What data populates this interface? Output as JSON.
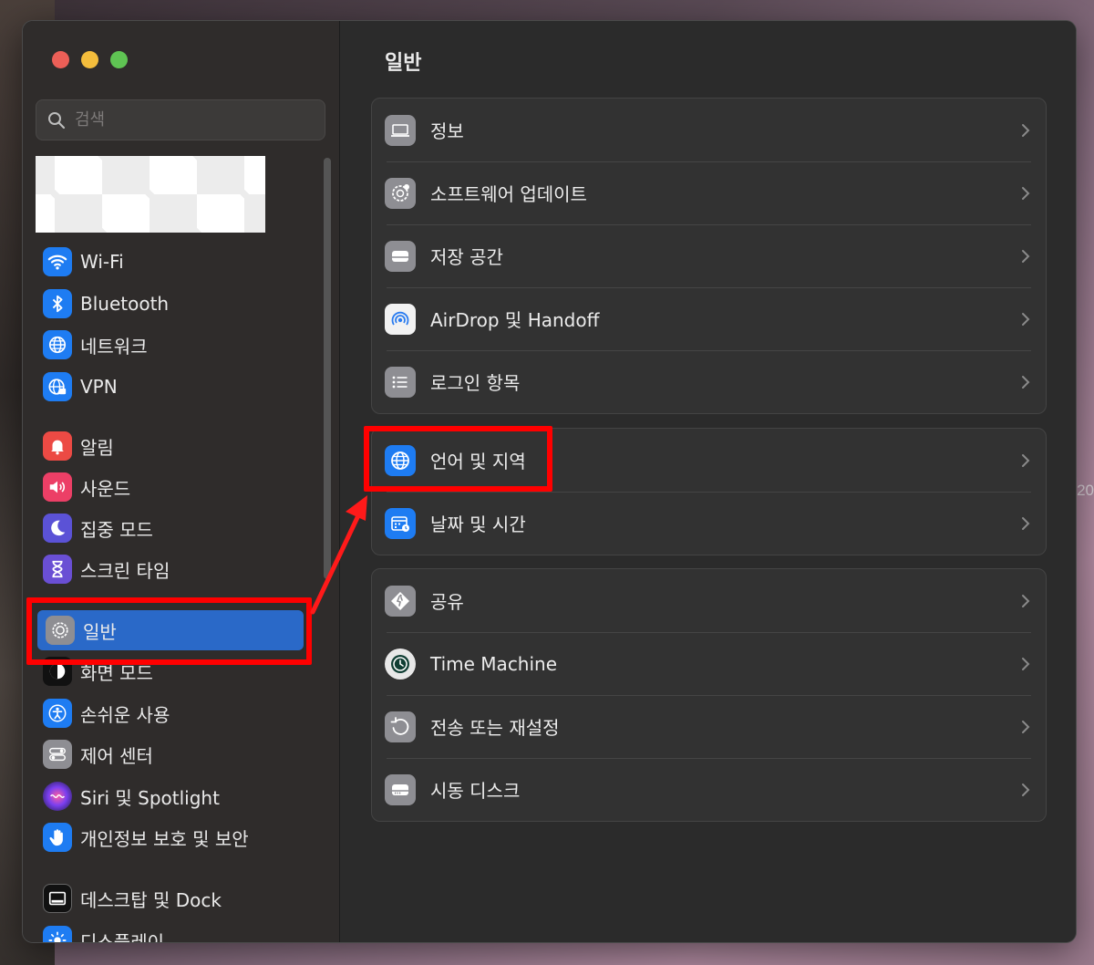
{
  "background": {
    "edge_text": "20"
  },
  "sidebar": {
    "search_placeholder": "검색",
    "items": [
      {
        "label": "Wi-Fi",
        "icon": "wifi-icon",
        "color": "#1e7cf2"
      },
      {
        "label": "Bluetooth",
        "icon": "bluetooth-icon",
        "color": "#1e7cf2"
      },
      {
        "label": "네트워크",
        "icon": "network-globe-icon",
        "color": "#1e7cf2"
      },
      {
        "label": "VPN",
        "icon": "vpn-globe-icon",
        "color": "#1e7cf2"
      },
      {
        "label": "알림",
        "icon": "bell-icon",
        "color": "#ec4a44"
      },
      {
        "label": "사운드",
        "icon": "speaker-icon",
        "color": "#ec3f66"
      },
      {
        "label": "집중 모드",
        "icon": "moon-icon",
        "color": "#5b52d6"
      },
      {
        "label": "스크린 타임",
        "icon": "hourglass-icon",
        "color": "#6a4fd4"
      },
      {
        "label": "일반",
        "icon": "gear-icon",
        "color": "#8e8e93",
        "selected": true
      },
      {
        "label": "화면 모드",
        "icon": "appearance-icon",
        "color": "#111111"
      },
      {
        "label": "손쉬운 사용",
        "icon": "accessibility-icon",
        "color": "#1e7cf2"
      },
      {
        "label": "제어 센터",
        "icon": "control-center-icon",
        "color": "#8e8e93"
      },
      {
        "label": "Siri 및 Spotlight",
        "icon": "siri-icon",
        "color": "#5a3fd0"
      },
      {
        "label": "개인정보 보호 및 보안",
        "icon": "hand-icon",
        "color": "#1e7cf2"
      },
      {
        "label": "데스크탑 및 Dock",
        "icon": "dock-icon",
        "color": "#111111"
      },
      {
        "label": "디스플레이",
        "icon": "display-sun-icon",
        "color": "#1e7cf2"
      }
    ]
  },
  "main": {
    "title": "일반",
    "groups": [
      [
        {
          "label": "정보",
          "icon": "laptop-icon"
        },
        {
          "label": "소프트웨어 업데이트",
          "icon": "software-update-gear-icon"
        },
        {
          "label": "저장 공간",
          "icon": "storage-drive-icon"
        },
        {
          "label": "AirDrop 및 Handoff",
          "icon": "airdrop-icon"
        },
        {
          "label": "로그인 항목",
          "icon": "list-icon"
        }
      ],
      [
        {
          "label": "언어 및 지역",
          "icon": "language-globe-icon"
        },
        {
          "label": "날짜 및 시간",
          "icon": "calendar-clock-icon"
        }
      ],
      [
        {
          "label": "공유",
          "icon": "sharing-icon"
        },
        {
          "label": "Time Machine",
          "icon": "time-machine-icon"
        },
        {
          "label": "전송 또는 재설정",
          "icon": "reset-icon"
        },
        {
          "label": "시동 디스크",
          "icon": "startup-disk-icon"
        }
      ]
    ]
  },
  "colors": {
    "accent_selected": "#2a69c8",
    "highlight_annotation": "#ff0000"
  }
}
